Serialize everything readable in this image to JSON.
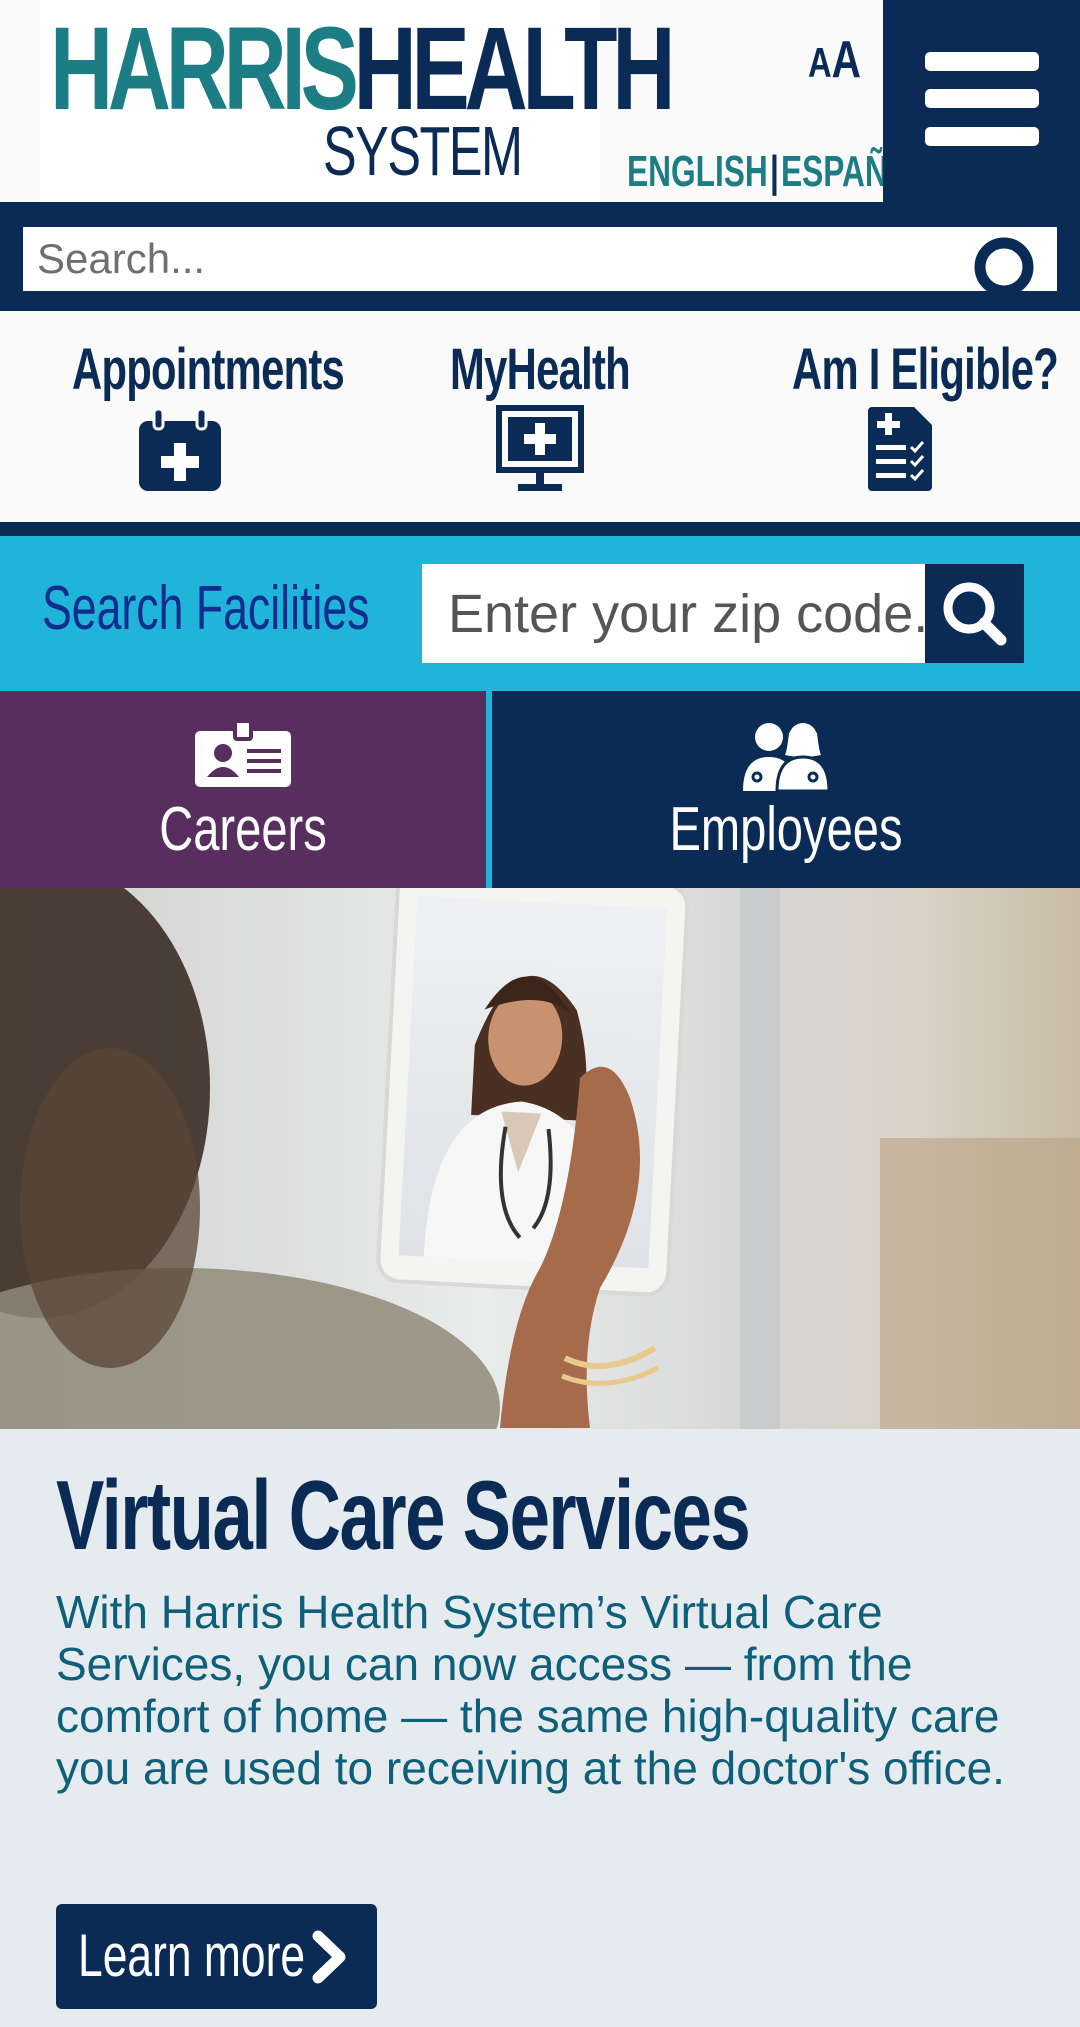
{
  "header": {
    "logo_part1": "HARRIS",
    "logo_part2": "HEALTH",
    "logo_part3": "SYSTEM",
    "font_size_small": "A",
    "font_size_large": "A",
    "lang_english": "ENGLISH",
    "lang_separator": "|",
    "lang_spanish": "ESPAÑOL",
    "menu_icon": "hamburger-menu-icon"
  },
  "search": {
    "placeholder": "Search...",
    "icon": "search-icon"
  },
  "quick_links": [
    {
      "label": "Appointments",
      "icon": "calendar-plus-icon"
    },
    {
      "label": "MyHealth",
      "icon": "monitor-medical-icon"
    },
    {
      "label": "Am I Eligible?",
      "icon": "clipboard-checklist-icon"
    }
  ],
  "facilities": {
    "label": "Search Facilities",
    "placeholder": "Enter your zip code...",
    "icon": "search-icon"
  },
  "tiles": {
    "careers": {
      "label": "Careers",
      "icon": "id-badge-icon"
    },
    "employees": {
      "label": "Employees",
      "icon": "doctors-icon"
    }
  },
  "promo": {
    "title": "Virtual Care Services",
    "text": "With Harris Health System’s Virtual Care Services, you can now access — from the comfort of home — the same high-quality care you are used to receiving at the doctor's office.",
    "button_label": "Learn more",
    "button_icon": "chevron-right-icon"
  },
  "colors": {
    "navy": "#0a2b55",
    "teal": "#1d7d84",
    "cyan": "#21b4d9",
    "purple": "#572e5e",
    "promo_bg": "#e6ebf0"
  }
}
